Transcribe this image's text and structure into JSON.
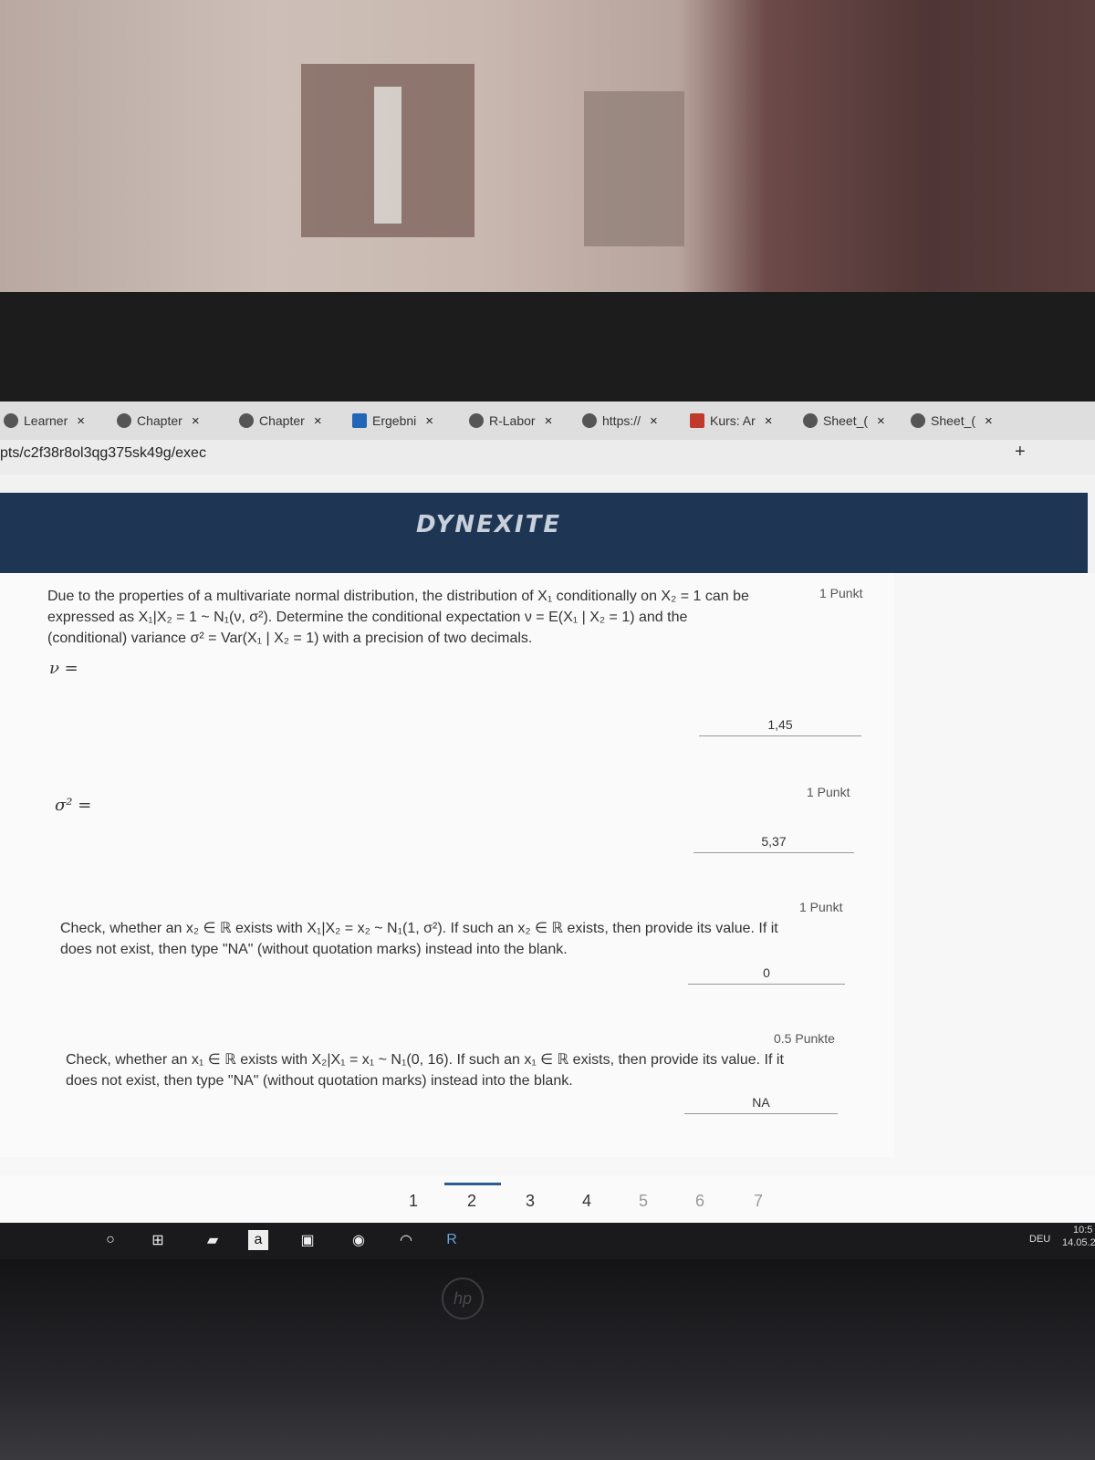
{
  "browser": {
    "tabs": [
      {
        "label": "Learner"
      },
      {
        "label": "Chapter"
      },
      {
        "label": "Chapter"
      },
      {
        "label": "Ergebni"
      },
      {
        "label": "R-Labor"
      },
      {
        "label": "https://"
      },
      {
        "label": "Kurs: Ar"
      },
      {
        "label": "Sheet_("
      },
      {
        "label": "Sheet_("
      }
    ],
    "close_glyph": "×",
    "new_tab_glyph": "+",
    "url": "pts/c2f38r8ol3qg375sk49g/exec"
  },
  "site": {
    "logo": "DYNEXITE"
  },
  "questions": [
    {
      "points": "1 Punkt",
      "text_line1": "Due to the properties of a multivariate normal distribution, the distribution of X₁ conditionally on X₂ = 1 can be",
      "text_line2": "expressed as X₁|X₂ = 1 ~ N₁(ν, σ²). Determine the conditional expectation ν = E(X₁ | X₂ = 1) and the",
      "text_line3": "(conditional) variance σ² = Var(X₁ | X₂ = 1) with a precision of two decimals.",
      "label": "ν =",
      "answer": "1,45"
    },
    {
      "points": "1 Punkt",
      "label": "σ² =",
      "answer": "5,37"
    },
    {
      "points": "1 Punkt",
      "text_line1": "Check, whether an x₂ ∈ ℝ exists with X₁|X₂ = x₂ ~ N₁(1, σ²). If such an x₂ ∈ ℝ exists, then provide its value. If it",
      "text_line2": "does not exist, then type \"NA\" (without quotation marks) instead into the blank.",
      "answer": "0"
    },
    {
      "points": "0.5 Punkte",
      "text_line1": "Check, whether an x₁ ∈ ℝ exists with X₂|X₁ = x₁ ~ N₁(0, 16). If such an x₁ ∈ ℝ exists, then provide its value. If it",
      "text_line2": "does not exist, then type \"NA\" (without quotation marks) instead into the blank.",
      "answer": "NA"
    }
  ],
  "pagination": {
    "pages": [
      "1",
      "2",
      "3",
      "4",
      "5",
      "6",
      "7"
    ],
    "active": "2"
  },
  "taskbar": {
    "app_a": "a",
    "app_r": "R",
    "lang": "DEU",
    "time": "10:5",
    "date": "14.05.2"
  },
  "laptop": {
    "brand": "hp"
  }
}
